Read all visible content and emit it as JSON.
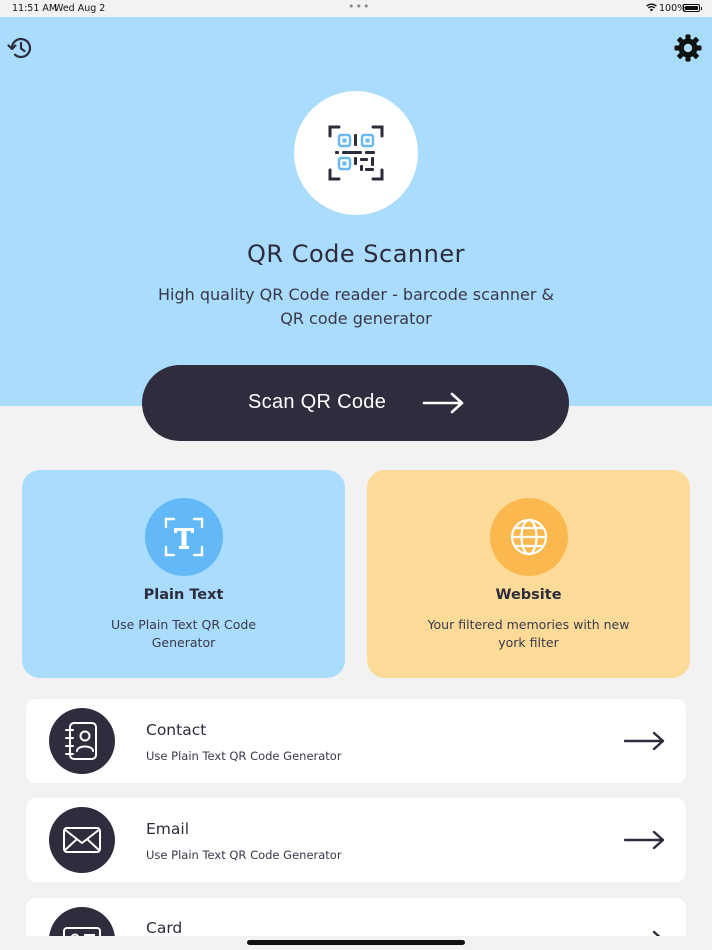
{
  "status_bar": {
    "time": "11:51 AM",
    "date": "Wed Aug 2",
    "dots": "•••",
    "battery": "100%"
  },
  "header": {
    "title": "QR Code Scanner",
    "subtitle": "High quality QR Code reader - barcode scanner & QR code generator"
  },
  "scan_button": {
    "label": "Scan QR Code"
  },
  "cards": [
    {
      "title": "Plain Text",
      "description": "Use Plain Text QR Code Generator",
      "icon": "text-icon"
    },
    {
      "title": "Website",
      "description": "Your filtered memories with new york filter",
      "icon": "globe-icon"
    }
  ],
  "list": [
    {
      "title": "Contact",
      "subtitle": "Use Plain Text QR Code Generator",
      "icon": "contact-icon"
    },
    {
      "title": "Email",
      "subtitle": "Use Plain Text QR Code Generator",
      "icon": "mail-icon"
    },
    {
      "title": "Card",
      "subtitle": "",
      "icon": "card-icon"
    }
  ],
  "colors": {
    "hero_bg": "#aadcfd",
    "dark": "#2e2c3d",
    "plain_card": "#aadcfd",
    "website_card": "#fcdb99",
    "plain_icon": "#63b8f7",
    "website_icon": "#fbb84f"
  }
}
